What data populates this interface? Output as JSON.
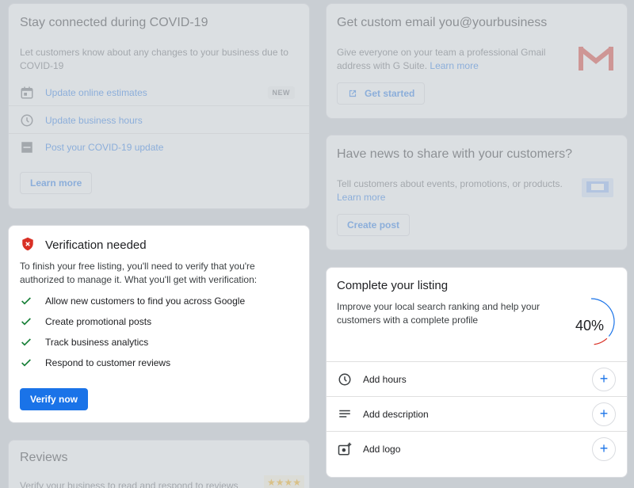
{
  "covid": {
    "title": "Stay connected during COVID-19",
    "desc": "Let customers know about any changes to your business due to COVID-19",
    "items": [
      {
        "icon": "calendar-icon",
        "label": "Update online estimates",
        "badge": "NEW"
      },
      {
        "icon": "clock-icon",
        "label": "Update business hours"
      },
      {
        "icon": "post-icon",
        "label": "Post your COVID-19 update"
      }
    ],
    "learn_more": "Learn more"
  },
  "email": {
    "title": "Get custom email you@yourbusiness",
    "desc": "Give everyone on your team a professional Gmail address with G Suite.",
    "desc_link": "Learn more",
    "button": "Get started"
  },
  "news": {
    "title": "Have news to share with your customers?",
    "desc": "Tell customers about events, promotions, or products.",
    "desc_link": "Learn more",
    "button": "Create post"
  },
  "verification": {
    "title": "Verification needed",
    "desc": "To finish your free listing, you'll need to verify that you're authorized to manage it. What you'll get with verification:",
    "benefits": [
      "Allow new customers to find you across Google",
      "Create promotional posts",
      "Track business analytics",
      "Respond to customer reviews"
    ],
    "button": "Verify now"
  },
  "listing": {
    "title": "Complete your listing",
    "desc": "Improve your local search ranking and help your customers with a complete profile",
    "progress_label": "40%",
    "progress": 0.4,
    "tasks": [
      {
        "icon": "clock-icon",
        "label": "Add hours"
      },
      {
        "icon": "description-icon",
        "label": "Add description"
      },
      {
        "icon": "add-photo-icon",
        "label": "Add logo"
      }
    ],
    "plus": "+"
  },
  "reviews": {
    "title": "Reviews",
    "desc": "Verify your business to read and respond to reviews",
    "stars": "★★★★"
  },
  "colors": {
    "primary": "#1a73e8",
    "check": "#188038",
    "shield": "#d93025",
    "overlay": "#c9ced3"
  }
}
